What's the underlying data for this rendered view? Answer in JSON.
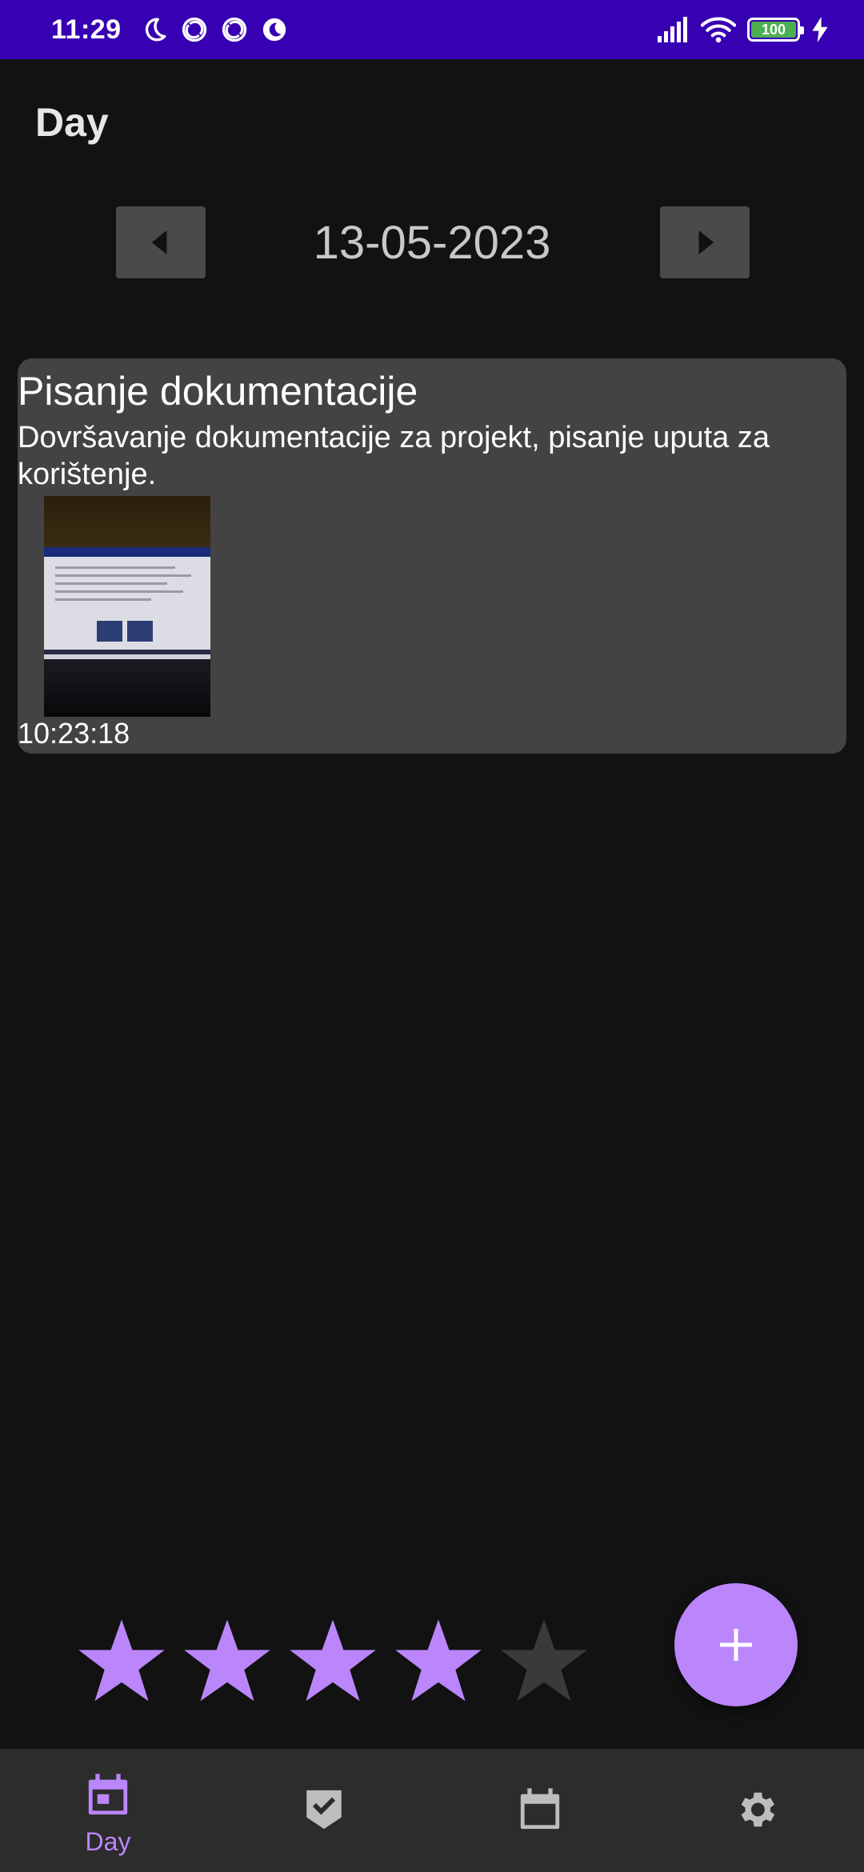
{
  "status_bar": {
    "time": "11:29",
    "battery_level": "100",
    "icons": [
      "moon-icon",
      "do-not-disturb-icon",
      "do-not-disturb-icon",
      "night-mode-icon",
      "signal-icon",
      "wifi-icon",
      "battery-icon",
      "charging-icon"
    ]
  },
  "header": {
    "title": "Day"
  },
  "date_nav": {
    "date": "13-05-2023",
    "prev_icon": "arrow-left-icon",
    "next_icon": "arrow-right-icon"
  },
  "entry": {
    "title": "Pisanje dokumentacije",
    "description": "Dovršavanje dokumentacije za projekt, pisanje uputa za korištenje.",
    "time": "10:23:18"
  },
  "rating": {
    "value": 4,
    "max": 5
  },
  "fab": {
    "icon": "plus-icon"
  },
  "bottom_nav": {
    "items": [
      {
        "label": "Day",
        "icon": "calendar-today-icon",
        "active": true
      },
      {
        "label": "",
        "icon": "task-check-icon",
        "active": false
      },
      {
        "label": "",
        "icon": "calendar-icon",
        "active": false
      },
      {
        "label": "",
        "icon": "gear-icon",
        "active": false
      }
    ]
  },
  "colors": {
    "status_bar": "#3700b3",
    "background": "#121212",
    "card": "#434343",
    "accent": "#bb86fc",
    "star_empty": "#3a3a3a",
    "nav_bar": "#2c2c2c"
  }
}
